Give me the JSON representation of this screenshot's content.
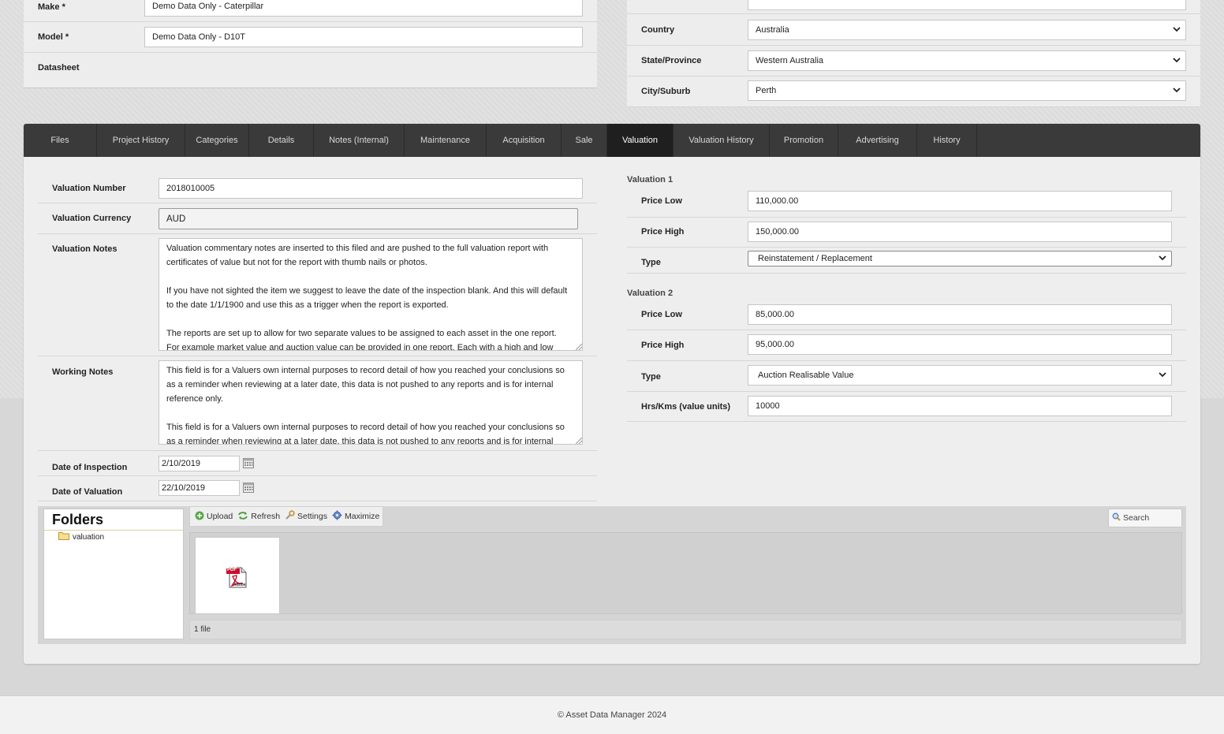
{
  "top_left": {
    "make_label": "Make *",
    "make_value": "Demo Data Only - Caterpillar",
    "model_label": "Model *",
    "model_value": "Demo Data Only - D10T",
    "datasheet_label": "Datasheet"
  },
  "top_right": {
    "country_label": "Country",
    "country_value": "Australia",
    "state_label": "State/Province",
    "state_value": "Western Australia",
    "city_label": "City/Suburb",
    "city_value": "Perth"
  },
  "tabs": [
    {
      "label": "Files"
    },
    {
      "label": "Project History"
    },
    {
      "label": "Categories"
    },
    {
      "label": "Details"
    },
    {
      "label": "Notes (Internal)"
    },
    {
      "label": "Maintenance"
    },
    {
      "label": "Acquisition"
    },
    {
      "label": "Sale"
    },
    {
      "label": "Valuation"
    },
    {
      "label": "Valuation History"
    },
    {
      "label": "Promotion"
    },
    {
      "label": "Advertising"
    },
    {
      "label": "History"
    }
  ],
  "active_tab": "Valuation",
  "valuation": {
    "number_label": "Valuation Number",
    "number_value": "2018010005",
    "currency_label": "Valuation Currency",
    "currency_value": "AUD",
    "notes_label": "Valuation Notes",
    "notes_value": "Valuation commentary notes are inserted to this filed and are pushed to the full valuation report with certificates of value but not for the report with thumb nails or photos.\n\nIf you have not sighted the item we suggest to leave the date of the inspection blank. And this will default to the date 1/1/1900 and use this as a trigger when the report is exported.\n\nThe reports are set up to allow for two separate values to be assigned to each asset in the one report.\nFor example market value and auction value can be provided in one report. Each with a high and low figure.",
    "working_label": "Working Notes",
    "working_value": "This field is for a Valuers own internal purposes to record detail of how you reached your conclusions so as a reminder when reviewing at a later date, this data is not pushed to any reports and is for internal reference only.\n\nThis field is for a Valuers own internal purposes to record detail of how you reached your conclusions so as a reminder when reviewing at a later date, this data is not pushed to any reports and is for internal",
    "inspection_label": "Date of Inspection",
    "inspection_value": "2/10/2019",
    "valuation_date_label": "Date of Valuation",
    "valuation_date_value": "22/10/2019"
  },
  "valuation1": {
    "title": "Valuation 1",
    "price_low_label": "Price Low",
    "price_low_value": "110,000.00",
    "price_high_label": "Price High",
    "price_high_value": "150,000.00",
    "type_label": "Type",
    "type_value": "Reinstatement / Replacement"
  },
  "valuation2": {
    "title": "Valuation 2",
    "price_low_label": "Price Low",
    "price_low_value": "85,000.00",
    "price_high_label": "Price High",
    "price_high_value": "95,000.00",
    "type_label": "Type",
    "type_value": "Auction Realisable Value",
    "units_label": "Hrs/Kms (value units)",
    "units_value": "10000"
  },
  "file_manager": {
    "folders_title": "Folders",
    "folder_name": "valuation",
    "upload": "Upload",
    "refresh": "Refresh",
    "settings": "Settings",
    "maximize": "Maximize",
    "search_placeholder": "Search",
    "file_badge": "PDF",
    "file_brand": "Adobe",
    "status": "1 file"
  },
  "footer": "© Asset Data Manager 2024",
  "colors": {
    "tabbar": "#3a3a3a",
    "active_tab": "#1f1f1f",
    "panel": "#ededed"
  }
}
